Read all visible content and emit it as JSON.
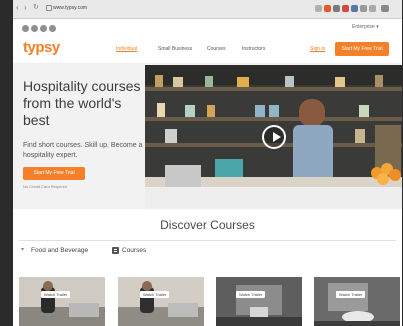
{
  "browser": {
    "url": "www.typsy.com"
  },
  "topbar": {
    "enterprise_label": "Enterprise"
  },
  "header": {
    "logo": "typsy",
    "nav": [
      "Individual",
      "Small Business",
      "Courses",
      "Instructors"
    ],
    "sign_in": "Sign in",
    "cta": "Start My Free Trial"
  },
  "hero": {
    "title": "Hospitality courses from the world's best",
    "subtitle": "Find short courses. Skill up. Become a hospitality expert.",
    "cta": "Start My Free Trial",
    "note": "No Credit Card Required"
  },
  "discover": {
    "title": "Discover Courses",
    "category": "Food and Beverage",
    "courses_label": "Courses"
  },
  "thumbnails": [
    {
      "label": "Watch Trailer"
    },
    {
      "label": "Watch Trailer"
    },
    {
      "label": "Watch Trailer"
    },
    {
      "label": "Watch Trailer"
    }
  ],
  "colors": {
    "brand_orange": "#f4802a",
    "text_dark": "#3d3d3d"
  }
}
